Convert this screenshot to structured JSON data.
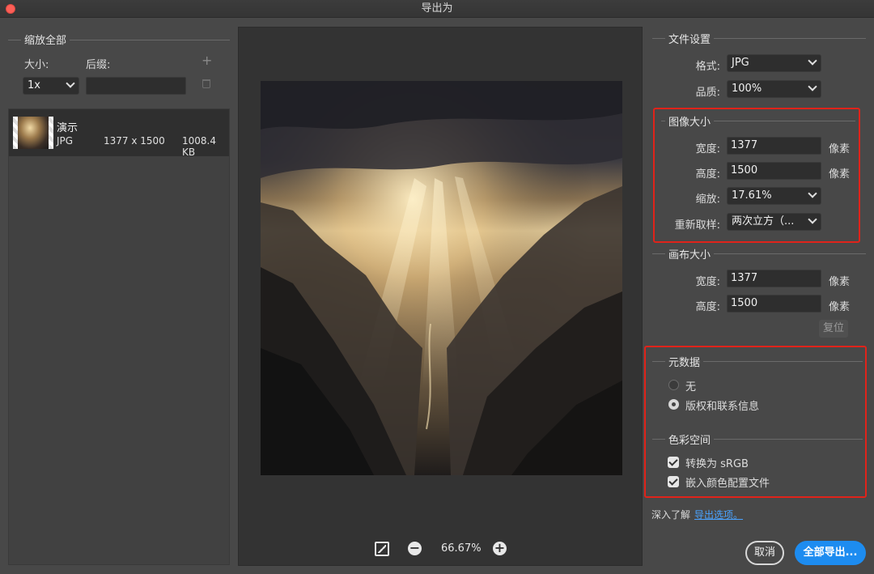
{
  "window": {
    "title": "导出为"
  },
  "left": {
    "group_title": "缩放全部",
    "size_label": "大小:",
    "suffix_label": "后缀:",
    "size_value": "1x",
    "suffix_value": "",
    "asset": {
      "name": "演示",
      "format": "JPG",
      "dimensions": "1377 x 1500",
      "filesize": "1008.4 KB"
    }
  },
  "preview": {
    "zoom": "66.67%"
  },
  "file_settings": {
    "title": "文件设置",
    "format_label": "格式:",
    "format_value": "JPG",
    "quality_label": "品质:",
    "quality_value": "100%"
  },
  "image_size": {
    "title": "图像大小",
    "width_label": "宽度:",
    "width_value": "1377",
    "height_label": "高度:",
    "height_value": "1500",
    "scale_label": "缩放:",
    "scale_value": "17.61%",
    "resample_label": "重新取样:",
    "resample_value": "两次立方（...",
    "unit": "像素"
  },
  "canvas_size": {
    "title": "画布大小",
    "width_label": "宽度:",
    "width_value": "1377",
    "height_label": "高度:",
    "height_value": "1500",
    "unit": "像素",
    "reset_label": "复位"
  },
  "metadata": {
    "title": "元数据",
    "options": [
      {
        "label": "无",
        "selected": false
      },
      {
        "label": "版权和联系信息",
        "selected": true
      }
    ]
  },
  "color_space": {
    "title": "色彩空间",
    "options": [
      {
        "label": "转换为 sRGB",
        "checked": true
      },
      {
        "label": "嵌入颜色配置文件",
        "checked": true
      }
    ]
  },
  "footer": {
    "learn_more": "深入了解",
    "export_options_link": "导出选项。",
    "cancel_label": "取消",
    "export_all_label": "全部导出..."
  },
  "colors": {
    "accent": "#1d8cf0",
    "highlight_border": "#e0231a",
    "link": "#4aa3ff"
  }
}
